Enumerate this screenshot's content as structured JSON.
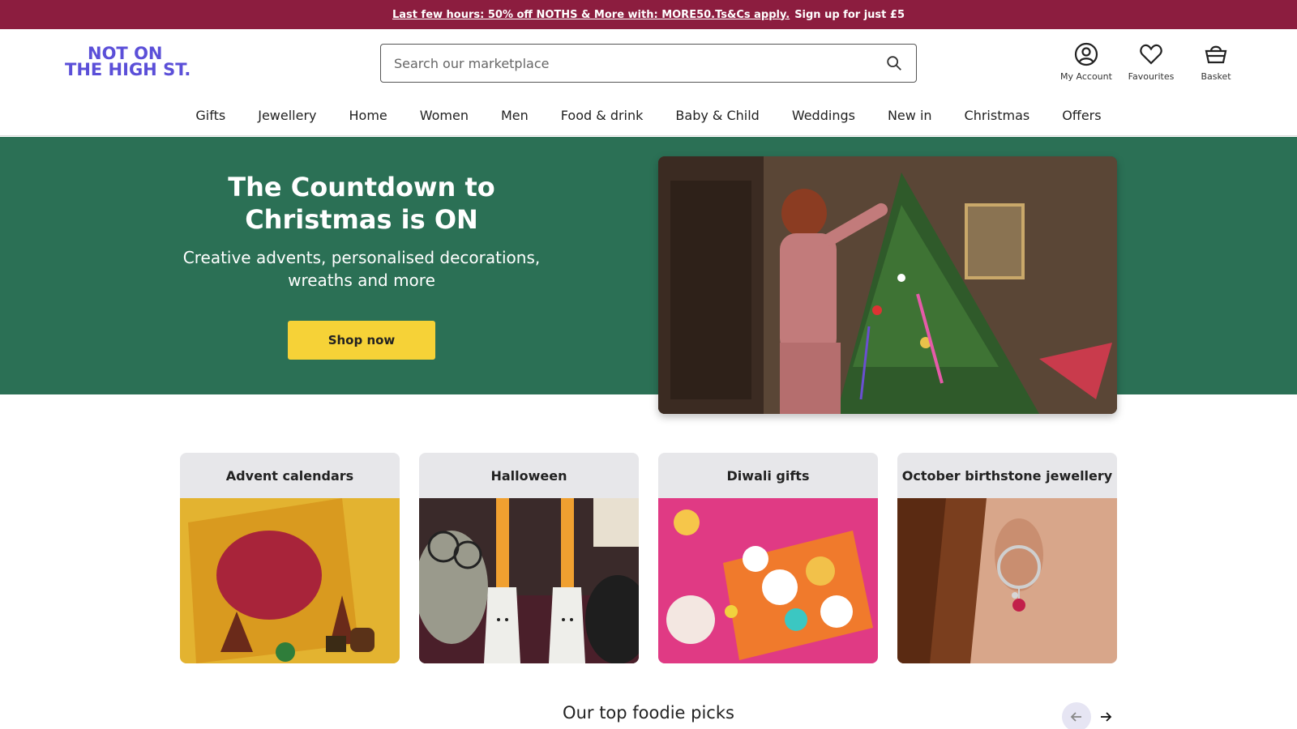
{
  "promo": {
    "link_text": "Last few hours: 50% off NOTHS & More with: MORE50.Ts&Cs apply.",
    "tail_text": "Sign up for just £5"
  },
  "header": {
    "logo_line1": "NOT ON",
    "logo_line2": "THE HIGH ST.",
    "search_placeholder": "Search our marketplace",
    "search_icon": "search-icon",
    "actions": [
      {
        "label": "My Account",
        "icon": "account-icon"
      },
      {
        "label": "Favourites",
        "icon": "heart-icon"
      },
      {
        "label": "Basket",
        "icon": "basket-icon"
      }
    ]
  },
  "nav": {
    "items": [
      "Gifts",
      "Jewellery",
      "Home",
      "Women",
      "Men",
      "Food & drink",
      "Baby & Child",
      "Weddings",
      "New in",
      "Christmas",
      "Offers"
    ]
  },
  "hero": {
    "title": "The Countdown to Christmas is ON",
    "subtitle": "Creative advents, personalised decorations, wreaths and more",
    "button_label": "Shop now"
  },
  "categories": [
    {
      "label": "Advent calendars"
    },
    {
      "label": "Halloween"
    },
    {
      "label": "Diwali gifts"
    },
    {
      "label": "October birthstone jewellery"
    }
  ],
  "section": {
    "title": "Our top foodie picks"
  },
  "colors": {
    "promo_bg": "#8c1d3f",
    "hero_bg": "#2b7055",
    "cta_yellow": "#f6d237",
    "logo_purple": "#5b4fd8"
  }
}
